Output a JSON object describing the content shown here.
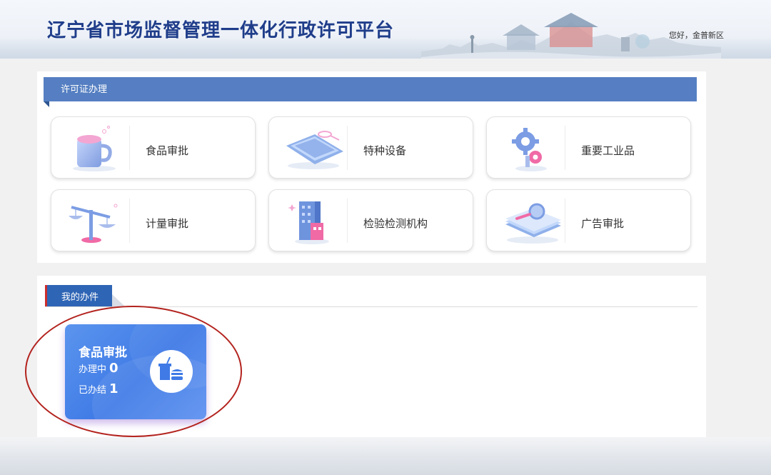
{
  "header": {
    "title": "辽宁省市场监督管理一体化行政许可平台",
    "greeting": "您好，金普新区"
  },
  "license_section": {
    "title": "许可证办理",
    "cards": [
      {
        "label": "食品审批",
        "icon": "cup-icon"
      },
      {
        "label": "特种设备",
        "icon": "tablet-device-icon"
      },
      {
        "label": "重要工业品",
        "icon": "gear-icon"
      },
      {
        "label": "计量审批",
        "icon": "scale-icon"
      },
      {
        "label": "检验检测机构",
        "icon": "building-icon"
      },
      {
        "label": "广告审批",
        "icon": "magnifier-book-icon"
      }
    ]
  },
  "my_jobs": {
    "title": "我的办件",
    "card": {
      "title": "食品审批",
      "in_progress_label": "办理中",
      "in_progress_count": "0",
      "done_label": "已办结",
      "done_count": "1",
      "icon": "food-drink-icon"
    }
  },
  "colors": {
    "title_blue": "#1f3d8a",
    "ribbon_blue": "#557fc2",
    "tab_blue": "#2f65b5",
    "card_blue": "#3f7ae6",
    "annotation_red": "#b3231e"
  }
}
